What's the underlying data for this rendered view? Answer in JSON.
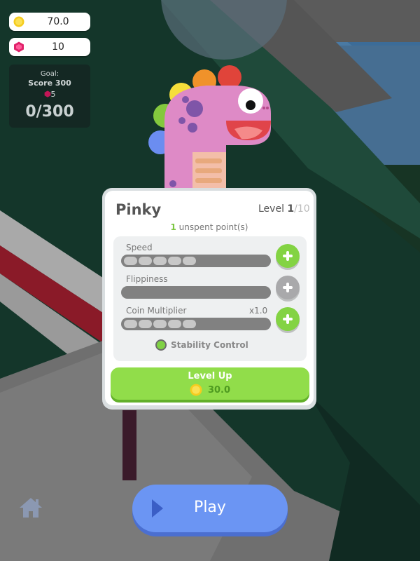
{
  "hud": {
    "coins": "70.0",
    "gems": "10",
    "coin_icon": "coin-icon",
    "gem_icon": "gem-icon"
  },
  "goal": {
    "label": "Goal:",
    "target": "Score 300",
    "reward": "5",
    "progress": "0/300"
  },
  "character": {
    "name": "Pinky",
    "level_label": "Level",
    "level": "1",
    "max_level": "/10",
    "unspent_count": "1",
    "unspent_text": " unspent point(s)"
  },
  "stats": [
    {
      "label": "Speed",
      "filled": 5,
      "total": 10,
      "can_upgrade": true
    },
    {
      "label": "Flippiness",
      "filled": 0,
      "total": 10,
      "can_upgrade": false
    },
    {
      "label": "Coin Multiplier",
      "multiplier": "x1.0",
      "filled": 5,
      "total": 10,
      "can_upgrade": true
    }
  ],
  "stability_control": {
    "label": "Stability Control",
    "enabled": true
  },
  "level_up": {
    "label": "Level Up",
    "cost": "30.0"
  },
  "play": {
    "label": "Play"
  },
  "colors": {
    "accent_green": "#91dd4a",
    "play_blue": "#6b95f3",
    "character_pink": "#df8ac7"
  }
}
